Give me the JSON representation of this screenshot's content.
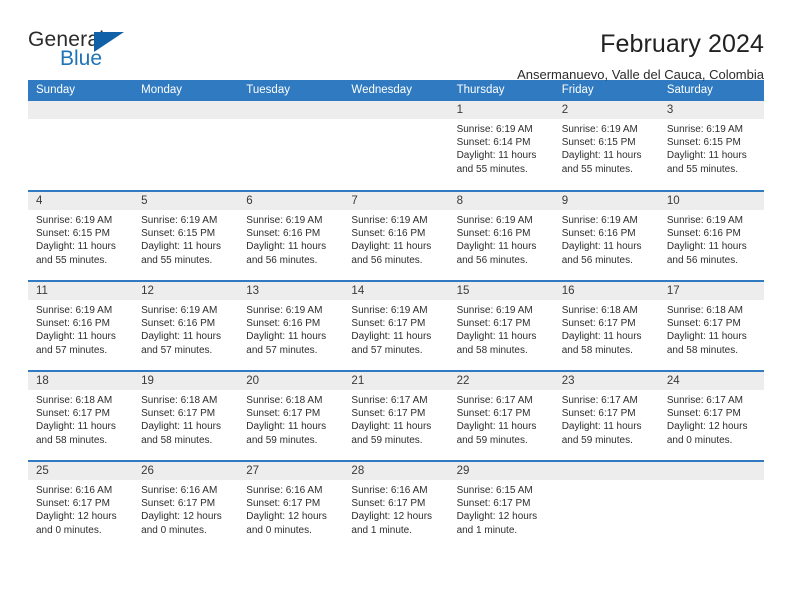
{
  "brand": {
    "name_top": "General",
    "name_bottom": "Blue",
    "accent_color": "#1f73b7",
    "triangle_color": "#1161a8"
  },
  "header": {
    "title": "February 2024",
    "location": "Ansermanuevo, Valle del Cauca, Colombia"
  },
  "theme": {
    "header_bar_color": "#2f7ac0",
    "daynum_band_color": "#ededed",
    "text_color": "#2e2e2e"
  },
  "weekday_headers": [
    "Sunday",
    "Monday",
    "Tuesday",
    "Wednesday",
    "Thursday",
    "Friday",
    "Saturday"
  ],
  "weeks": [
    [
      {
        "day": "",
        "info": ""
      },
      {
        "day": "",
        "info": ""
      },
      {
        "day": "",
        "info": ""
      },
      {
        "day": "",
        "info": ""
      },
      {
        "day": "1",
        "info": "Sunrise: 6:19 AM\nSunset: 6:14 PM\nDaylight: 11 hours\nand 55 minutes."
      },
      {
        "day": "2",
        "info": "Sunrise: 6:19 AM\nSunset: 6:15 PM\nDaylight: 11 hours\nand 55 minutes."
      },
      {
        "day": "3",
        "info": "Sunrise: 6:19 AM\nSunset: 6:15 PM\nDaylight: 11 hours\nand 55 minutes."
      }
    ],
    [
      {
        "day": "4",
        "info": "Sunrise: 6:19 AM\nSunset: 6:15 PM\nDaylight: 11 hours\nand 55 minutes."
      },
      {
        "day": "5",
        "info": "Sunrise: 6:19 AM\nSunset: 6:15 PM\nDaylight: 11 hours\nand 55 minutes."
      },
      {
        "day": "6",
        "info": "Sunrise: 6:19 AM\nSunset: 6:16 PM\nDaylight: 11 hours\nand 56 minutes."
      },
      {
        "day": "7",
        "info": "Sunrise: 6:19 AM\nSunset: 6:16 PM\nDaylight: 11 hours\nand 56 minutes."
      },
      {
        "day": "8",
        "info": "Sunrise: 6:19 AM\nSunset: 6:16 PM\nDaylight: 11 hours\nand 56 minutes."
      },
      {
        "day": "9",
        "info": "Sunrise: 6:19 AM\nSunset: 6:16 PM\nDaylight: 11 hours\nand 56 minutes."
      },
      {
        "day": "10",
        "info": "Sunrise: 6:19 AM\nSunset: 6:16 PM\nDaylight: 11 hours\nand 56 minutes."
      }
    ],
    [
      {
        "day": "11",
        "info": "Sunrise: 6:19 AM\nSunset: 6:16 PM\nDaylight: 11 hours\nand 57 minutes."
      },
      {
        "day": "12",
        "info": "Sunrise: 6:19 AM\nSunset: 6:16 PM\nDaylight: 11 hours\nand 57 minutes."
      },
      {
        "day": "13",
        "info": "Sunrise: 6:19 AM\nSunset: 6:16 PM\nDaylight: 11 hours\nand 57 minutes."
      },
      {
        "day": "14",
        "info": "Sunrise: 6:19 AM\nSunset: 6:17 PM\nDaylight: 11 hours\nand 57 minutes."
      },
      {
        "day": "15",
        "info": "Sunrise: 6:19 AM\nSunset: 6:17 PM\nDaylight: 11 hours\nand 58 minutes."
      },
      {
        "day": "16",
        "info": "Sunrise: 6:18 AM\nSunset: 6:17 PM\nDaylight: 11 hours\nand 58 minutes."
      },
      {
        "day": "17",
        "info": "Sunrise: 6:18 AM\nSunset: 6:17 PM\nDaylight: 11 hours\nand 58 minutes."
      }
    ],
    [
      {
        "day": "18",
        "info": "Sunrise: 6:18 AM\nSunset: 6:17 PM\nDaylight: 11 hours\nand 58 minutes."
      },
      {
        "day": "19",
        "info": "Sunrise: 6:18 AM\nSunset: 6:17 PM\nDaylight: 11 hours\nand 58 minutes."
      },
      {
        "day": "20",
        "info": "Sunrise: 6:18 AM\nSunset: 6:17 PM\nDaylight: 11 hours\nand 59 minutes."
      },
      {
        "day": "21",
        "info": "Sunrise: 6:17 AM\nSunset: 6:17 PM\nDaylight: 11 hours\nand 59 minutes."
      },
      {
        "day": "22",
        "info": "Sunrise: 6:17 AM\nSunset: 6:17 PM\nDaylight: 11 hours\nand 59 minutes."
      },
      {
        "day": "23",
        "info": "Sunrise: 6:17 AM\nSunset: 6:17 PM\nDaylight: 11 hours\nand 59 minutes."
      },
      {
        "day": "24",
        "info": "Sunrise: 6:17 AM\nSunset: 6:17 PM\nDaylight: 12 hours\nand 0 minutes."
      }
    ],
    [
      {
        "day": "25",
        "info": "Sunrise: 6:16 AM\nSunset: 6:17 PM\nDaylight: 12 hours\nand 0 minutes."
      },
      {
        "day": "26",
        "info": "Sunrise: 6:16 AM\nSunset: 6:17 PM\nDaylight: 12 hours\nand 0 minutes."
      },
      {
        "day": "27",
        "info": "Sunrise: 6:16 AM\nSunset: 6:17 PM\nDaylight: 12 hours\nand 0 minutes."
      },
      {
        "day": "28",
        "info": "Sunrise: 6:16 AM\nSunset: 6:17 PM\nDaylight: 12 hours\nand 1 minute."
      },
      {
        "day": "29",
        "info": "Sunrise: 6:15 AM\nSunset: 6:17 PM\nDaylight: 12 hours\nand 1 minute."
      },
      {
        "day": "",
        "info": ""
      },
      {
        "day": "",
        "info": ""
      }
    ]
  ]
}
